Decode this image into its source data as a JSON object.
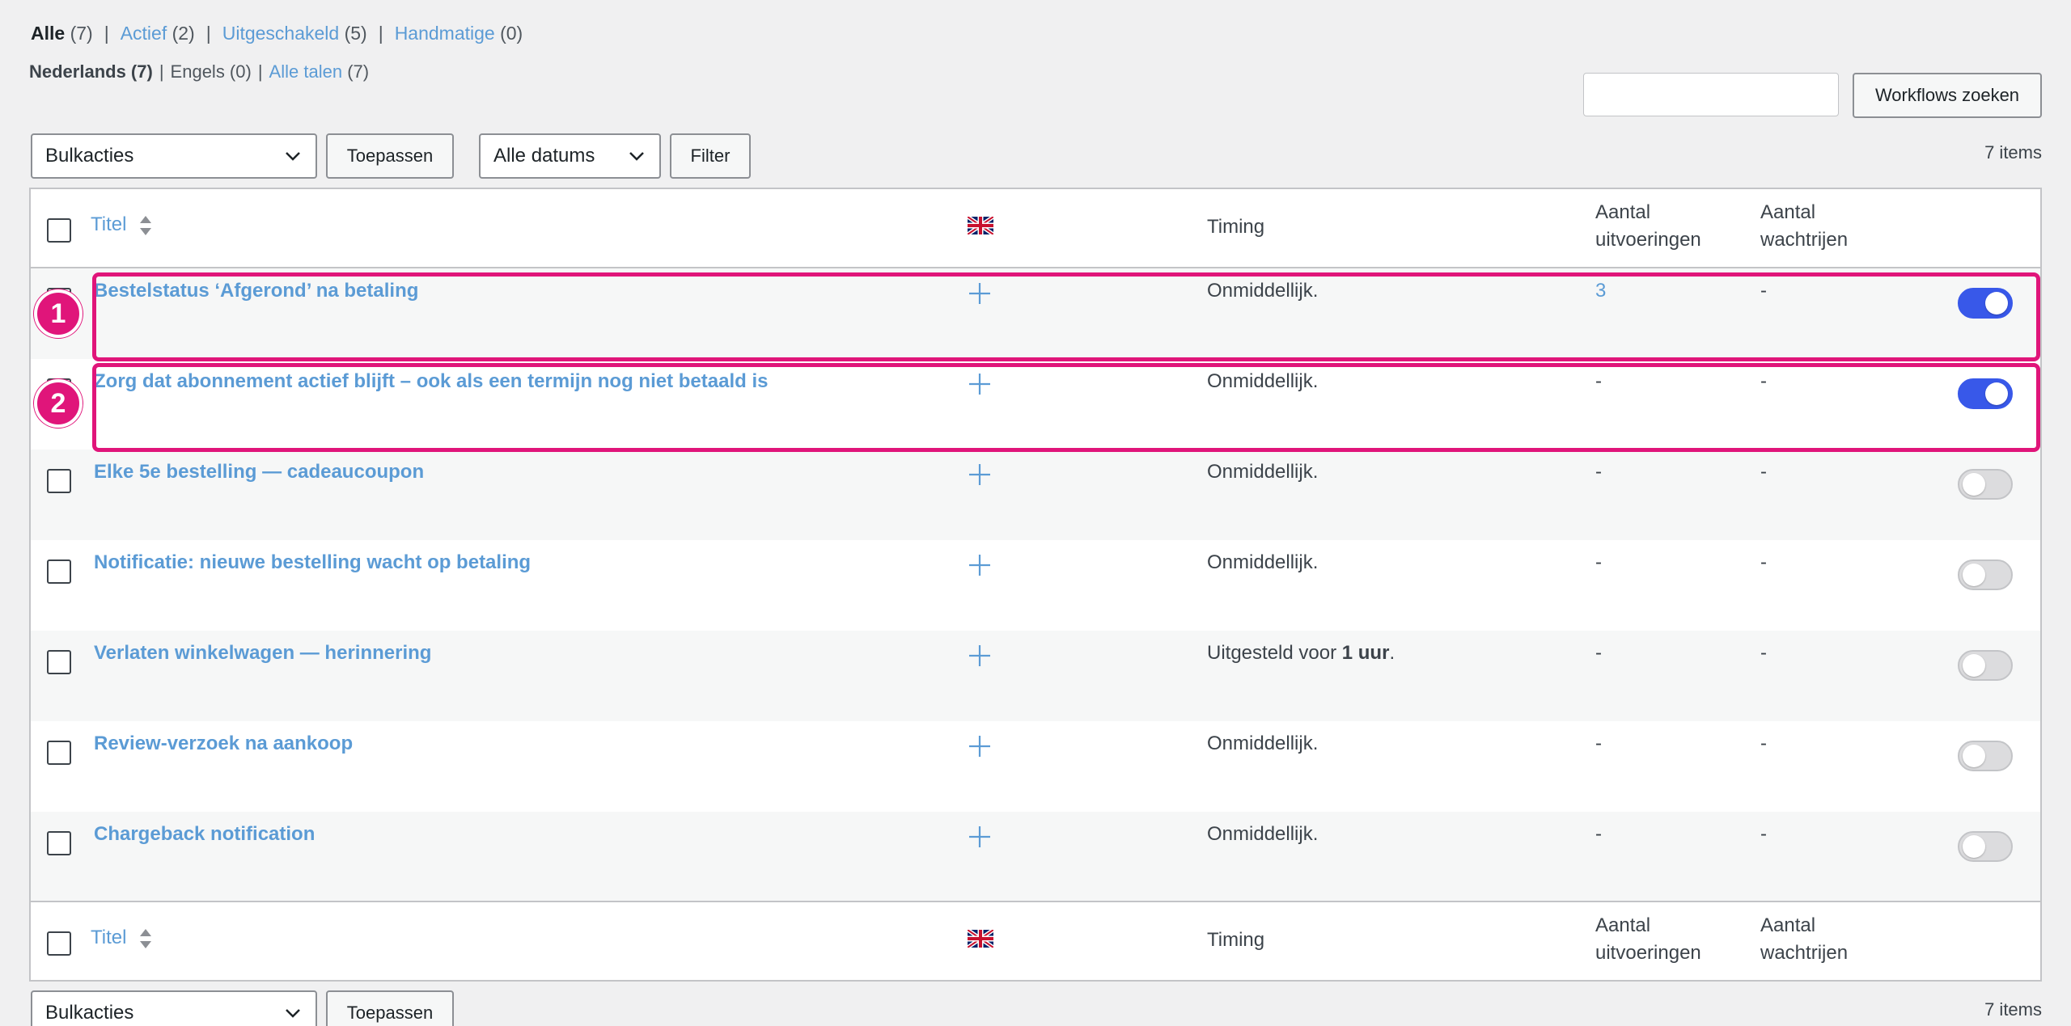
{
  "status_filters": [
    {
      "label": "Alle",
      "count": "(7)",
      "current": true
    },
    {
      "label": "Actief",
      "count": "(2)"
    },
    {
      "label": "Uitgeschakeld",
      "count": "(5)"
    },
    {
      "label": "Handmatige",
      "count": "(0)"
    }
  ],
  "language_filters": {
    "nl": "Nederlands (7)",
    "en": "Engels (0)",
    "all_label": "Alle talen",
    "all_count": "(7)"
  },
  "search": {
    "value": "",
    "button": "Workflows zoeken"
  },
  "bulk": {
    "selected": "Bulkacties",
    "apply": "Toepassen"
  },
  "dates": {
    "selected": "Alle datums",
    "filter": "Filter"
  },
  "items_count": "7 items",
  "columns": {
    "title": "Titel",
    "timing": "Timing",
    "runs_line1": "Aantal",
    "runs_line2": "uitvoeringen",
    "queue_line1": "Aantal",
    "queue_line2": "wachtrijen"
  },
  "rows": [
    {
      "title": "Bestelstatus ‘Afgerond’ na betaling",
      "timing": "Onmiddellijk.",
      "runs": "3",
      "queue": "-",
      "active": true
    },
    {
      "title": "Zorg dat abonnement actief blijft – ook als een termijn nog niet betaald is",
      "timing": "Onmiddellijk.",
      "runs": "-",
      "queue": "-",
      "active": true
    },
    {
      "title": "Elke 5e bestelling — cadeaucoupon",
      "timing": "Onmiddellijk.",
      "runs": "-",
      "queue": "-",
      "active": false
    },
    {
      "title": "Notificatie: nieuwe bestelling wacht op betaling",
      "timing": "Onmiddellijk.",
      "runs": "-",
      "queue": "-",
      "active": false
    },
    {
      "title": "Verlaten winkelwagen — herinnering",
      "timing_prefix": "Uitgesteld voor ",
      "timing_bold": "1 uur",
      "timing_suffix": ".",
      "runs": "-",
      "queue": "-",
      "active": false
    },
    {
      "title": "Review-verzoek na aankoop",
      "timing": "Onmiddellijk.",
      "runs": "-",
      "queue": "-",
      "active": false
    },
    {
      "title": "Chargeback notification",
      "timing": "Onmiddellijk.",
      "runs": "-",
      "queue": "-",
      "active": false
    }
  ],
  "annotations": [
    "1",
    "2"
  ],
  "colors": {
    "accent": "#3858e9",
    "link": "#5b9bd5",
    "highlight": "#e0157a"
  }
}
